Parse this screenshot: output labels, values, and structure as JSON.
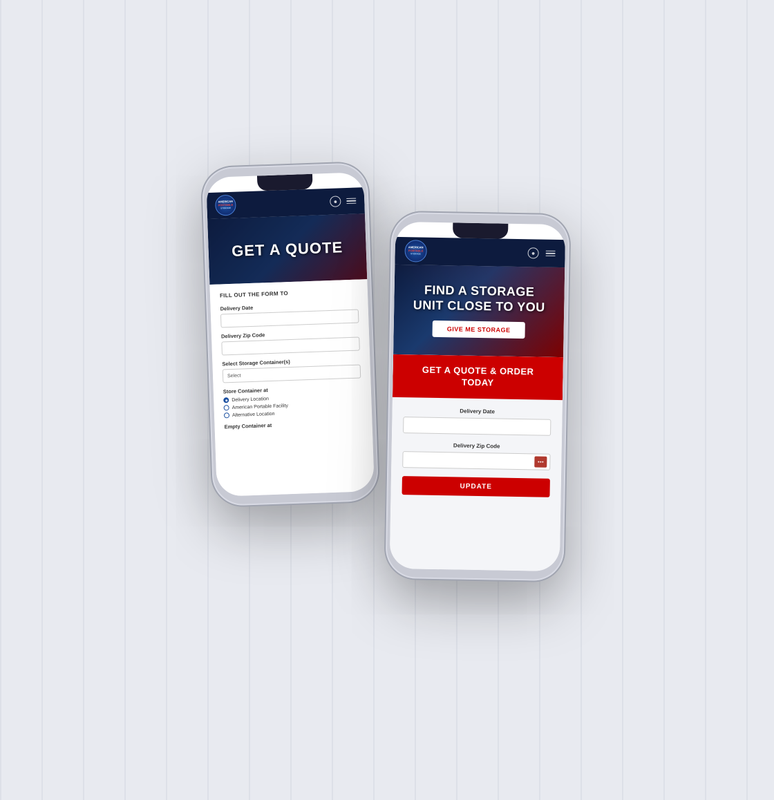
{
  "background": {
    "color": "#e8eaf0"
  },
  "phone_back": {
    "header": {
      "logo_text": "AMERICAN\nPORTABLE\nSTORAGE"
    },
    "hero": {
      "title": "GET A QUOTE"
    },
    "form": {
      "subtitle": "FILL OUT THE FORM TO",
      "delivery_date_label": "Delivery Date",
      "delivery_zip_label": "Delivery Zip Code",
      "select_storage_label": "Select Storage Container(s)",
      "select_placeholder": "Select",
      "store_container_label": "Store Container at",
      "radio_options": [
        {
          "label": "Delivery Location",
          "checked": true
        },
        {
          "label": "American Portable Facility",
          "checked": false
        },
        {
          "label": "Alternative Location",
          "checked": false
        }
      ],
      "empty_container_label": "Empty Container at"
    }
  },
  "phone_front": {
    "header": {
      "logo_text": "AMERICAN\nPORTABLE\nSTORAGE"
    },
    "hero": {
      "title": "FIND A STORAGE\nUNIT CLOSE TO YOU",
      "button_label": "GIVE ME STORAGE"
    },
    "form": {
      "cta_button_label": "GET A QUOTE & ORDER TODAY",
      "delivery_date_label": "Delivery Date",
      "delivery_zip_label": "Delivery Zip Code",
      "update_button_label": "UPDATE"
    }
  }
}
